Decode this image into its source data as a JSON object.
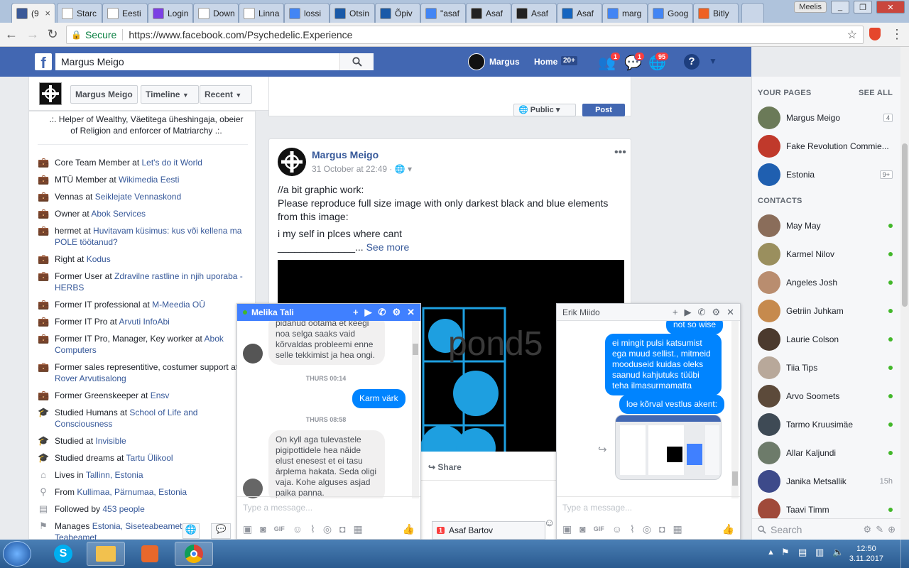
{
  "browser": {
    "tabs": [
      {
        "label": "(9",
        "fav": "#3b5998",
        "icon": "facebook-icon",
        "active": true,
        "closable": true
      },
      {
        "label": "Starc",
        "fav": "#ffffff",
        "icon": "stats-icon"
      },
      {
        "label": "Eesti",
        "fav": "#ffffff",
        "icon": "page-icon"
      },
      {
        "label": "Login",
        "fav": "#7b3fe4",
        "icon": "login-icon"
      },
      {
        "label": "Down",
        "fav": "#ffffff",
        "icon": "download-icon"
      },
      {
        "label": "Linna",
        "fav": "#ffffff",
        "icon": "page-icon"
      },
      {
        "label": "lossi",
        "fav": "#4285f4",
        "icon": "google-icon"
      },
      {
        "label": "Otsin",
        "fav": "#1a5aa8",
        "icon": "building-icon"
      },
      {
        "label": "Õpiv",
        "fav": "#1a5aa8",
        "icon": "building-icon"
      },
      {
        "label": "\"asaf",
        "fav": "#4285f4",
        "icon": "google-icon"
      },
      {
        "label": "Asaf",
        "fav": "#222222",
        "icon": "wikipedia-icon"
      },
      {
        "label": "Asaf",
        "fav": "#222222",
        "icon": "wikipedia-icon"
      },
      {
        "label": "Asaf",
        "fav": "#1565c0",
        "icon": "cb-icon"
      },
      {
        "label": "marg",
        "fav": "#4285f4",
        "icon": "google-icon"
      },
      {
        "label": "Goog",
        "fav": "#4285f4",
        "icon": "translate-icon"
      },
      {
        "label": "Bitly",
        "fav": "#ee6123",
        "icon": "bitly-icon"
      }
    ],
    "profile_name": "Meelis",
    "secure_label": "Secure",
    "url": "https://www.facebook.com/Psychedelic.Experience"
  },
  "fb": {
    "search_value": "Margus Meigo",
    "user_name": "Margus",
    "home_label": "Home",
    "home_count": "20+",
    "friend_badge": "1",
    "messages_badge": "1",
    "notif_badge": "95",
    "page_header": {
      "name_button": "Margus Meigo",
      "timeline_button": "Timeline",
      "recent_button": "Recent"
    },
    "composer": {
      "privacy": "Public",
      "post_button": "Post"
    },
    "intro": {
      "bio_line1": ".:. Helper of Wealthy, Väetitega üheshingaja, obeier",
      "bio_line2": "of Religion and enforcer of Matriarchy .:.",
      "items": [
        {
          "icon": "work-icon",
          "prefix": "Core Team Member at ",
          "link": "Let's do it World"
        },
        {
          "icon": "work-icon",
          "prefix": "MTÜ Member at ",
          "link": "Wikimedia Eesti"
        },
        {
          "icon": "work-icon",
          "prefix": "Vennas at ",
          "link": "Seiklejate Vennaskond"
        },
        {
          "icon": "work-icon",
          "prefix": "Owner at ",
          "link": "Abok Services"
        },
        {
          "icon": "work-icon",
          "prefix": "hermet at ",
          "link": "Huvitavam küsimus: kus või kellena ma POLE töötanud?"
        },
        {
          "icon": "work-icon",
          "prefix": "Right at ",
          "link": "Kodus"
        },
        {
          "icon": "work-icon",
          "prefix": "Former User at ",
          "link": "Zdravilne rastline in njih uporaba - HERBS"
        },
        {
          "icon": "work-icon",
          "prefix": "Former IT professional at ",
          "link": "M-Meedia OÜ"
        },
        {
          "icon": "work-icon",
          "prefix": "Former IT Pro at ",
          "link": "Arvuti InfoAbi"
        },
        {
          "icon": "work-icon",
          "prefix": "Former IT Pro, Manager, Key worker at ",
          "link": "Abok Computers"
        },
        {
          "icon": "work-icon",
          "prefix": "Former sales representitive, costumer support at ",
          "link": "Rover Arvutisalong"
        },
        {
          "icon": "work-icon",
          "prefix": "Former Greenskeeper at ",
          "link": "Ensv"
        },
        {
          "icon": "education-icon",
          "prefix": "Studied Humans at ",
          "link": "School of Life and Consciousness"
        },
        {
          "icon": "education-icon",
          "prefix": "Studied at ",
          "link": "Invisible"
        },
        {
          "icon": "education-icon",
          "prefix": "Studied dreams at ",
          "link": "Tartu Ülikool"
        },
        {
          "icon": "home-icon",
          "prefix": "Lives in ",
          "link": "Tallinn, Estonia"
        },
        {
          "icon": "location-icon",
          "prefix": "From ",
          "link": "Kullimaa, Pärnumaa, Estonia"
        },
        {
          "icon": "followers-icon",
          "prefix": "Followed by ",
          "link": "453 people"
        }
      ],
      "manages_prefix": "Manages ",
      "manages_link": "Estonia, Siseteabeamet",
      "manages_line2": "Teabeamet"
    },
    "post": {
      "author": "Margus Meigo",
      "time": "31 October at 22:49 ·",
      "text_l1": "//a bit graphic work:",
      "text_l2": "Please reproduce full size image with only darkest black and blue elements from this image:",
      "text_l3": "i my self in plces where cant",
      "text_l4": "______________...",
      "see_more": "See more",
      "watermark": "pond5",
      "share_label": "Share"
    },
    "right": {
      "pages_header": "YOUR PAGES",
      "see_all": "SEE ALL",
      "pages": [
        {
          "name": "Margus Meigo",
          "count": "4",
          "color": "#6b7a58"
        },
        {
          "name": "Fake Revolution Commie...",
          "count": "",
          "color": "#c0392b"
        },
        {
          "name": "Estonia",
          "count": "9+",
          "color": "#1f5fb0"
        }
      ],
      "contacts_header": "CONTACTS",
      "contacts": [
        {
          "name": "May May",
          "status": "online",
          "color": "#8a6d5a"
        },
        {
          "name": "Karmel Nilov",
          "status": "online",
          "color": "#9a8f5e"
        },
        {
          "name": "Angeles Josh",
          "status": "online",
          "color": "#b98d6f"
        },
        {
          "name": "Getriin Juhkam",
          "status": "online",
          "color": "#c68a4d"
        },
        {
          "name": "Laurie Colson",
          "status": "online",
          "color": "#4b3a2e"
        },
        {
          "name": "Tiia Tips",
          "status": "online",
          "color": "#b8a89a"
        },
        {
          "name": "Arvo Soomets",
          "status": "online",
          "color": "#5c4a3a"
        },
        {
          "name": "Tarmo Kruusimäe",
          "status": "online",
          "color": "#3e4a55"
        },
        {
          "name": "Allar Kaljundi",
          "status": "online",
          "color": "#6d7b6a"
        },
        {
          "name": "Janika Metsallik",
          "status": "15h",
          "color": "#3d4a8a"
        },
        {
          "name": "Taavi Timm",
          "status": "online",
          "color": "#a04a3a"
        }
      ],
      "search_placeholder": "Search"
    },
    "chat1": {
      "name": "Melika Tali",
      "msg1": "pidanud ootama et keegi noa selga saaks vaid kõrvaldas probleemi enne selle tekkimist ja hea ongi.",
      "time1": "THURS 00:14",
      "out1": "Karm värk",
      "time2": "THURS 08:58",
      "msg2": "On kyll aga tulevastele pigipottidele hea näide elust enesest et ei tasu ärplema hakata. Seda oligi vaja. Kohe alguses asjad paika panna.",
      "placeholder": "Type a message..."
    },
    "chat2": {
      "name": "Erik Miido",
      "out0": "not so wise",
      "out1": "ei mingit pulsi katsumist ega muud sellist., mitmeid mooduseid kuidas oleks saanud kahjutuks tüübi teha ilmasurmamatta",
      "out2": "loe kõrval vestlus akent:",
      "placeholder": "Type a message..."
    },
    "chat_tab": {
      "badge": "1",
      "name": "Asaf Bartov"
    }
  },
  "taskbar": {
    "time": "12:50",
    "date": "3.11.2017"
  }
}
